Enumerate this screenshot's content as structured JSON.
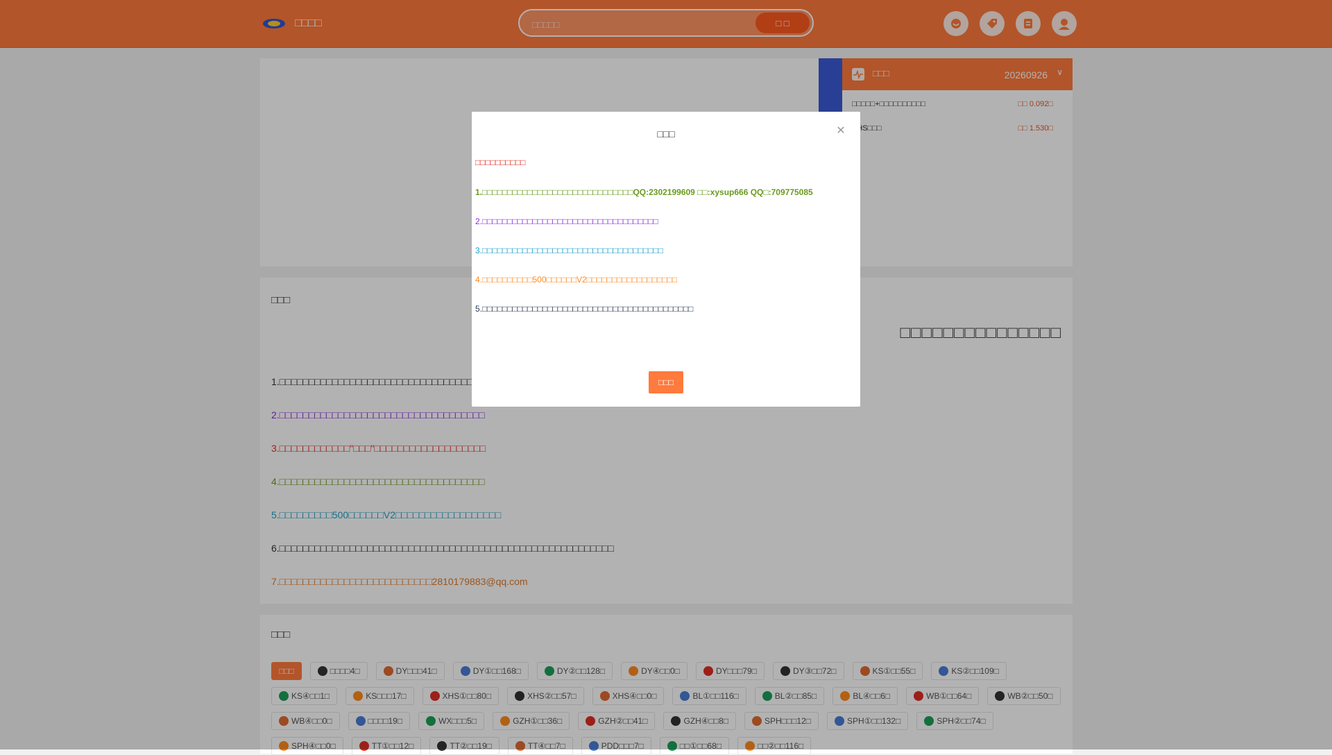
{
  "header": {
    "site_name": "□□□□",
    "search_placeholder": "□□□□□",
    "search_button": "□ □",
    "icons": [
      "service-icon",
      "tag-icon",
      "orders-icon",
      "user-avatar-icon"
    ]
  },
  "rank": {
    "title": "□□□",
    "date": "20260926",
    "rows": [
      {
        "name": "□□□□□+□□□□□□□□□□",
        "value": "□□ 0.092□"
      },
      {
        "name": "XHS□□□",
        "value": "□□ 1.530□"
      }
    ]
  },
  "notice": {
    "title": "□□□",
    "marquee": "□□□□□□□□□□□□□□□",
    "lines": [
      "1.□□□□□□□□□□□□□□□□□□□□□□□□□□□□□□□□□□□QQ",
      "2.□□□□□□□□□□□□□□□□□□□□□□□□□□□□□□□□□□□",
      "3.□□□□□□□□□□□□\"□□□\"□□□□□□□□□□□□□□□□□□□",
      "4.□□□□□□□□□□□□□□□□□□□□□□□□□□□□□□□□□□□",
      "5.□□□□□□□□□500□□□□□□V2□□□□□□□□□□□□□□□□□□",
      "6.□□□□□□□□□□□□□□□□□□□□□□□□□□□□□□□□□□□□□□□□□□□□□□□□□□□□□□□□□",
      "7.□□□□□□□□□□□□□□□□□□□□□□□□□□2810179883@qq.com"
    ]
  },
  "goods": {
    "title": "□□□",
    "tags": [
      {
        "label": "□□□",
        "active": true
      },
      {
        "label": "□□□□4□"
      },
      {
        "label": "DY□□□41□"
      },
      {
        "label": "DY①□□168□"
      },
      {
        "label": "DY②□□128□"
      },
      {
        "label": "DY④□□0□"
      },
      {
        "label": "DY□□□79□"
      },
      {
        "label": "DY③□□72□"
      },
      {
        "label": "KS①□□55□"
      },
      {
        "label": "KS②□□109□"
      },
      {
        "label": "KS④□□1□"
      },
      {
        "label": "KS□□□17□"
      },
      {
        "label": "XHS①□□80□"
      },
      {
        "label": "XHS②□□57□"
      },
      {
        "label": "XHS④□□0□"
      },
      {
        "label": "BL①□□116□"
      },
      {
        "label": "BL②□□85□"
      },
      {
        "label": "BL④□□6□"
      },
      {
        "label": "WB①□□64□"
      },
      {
        "label": "WB②□□50□"
      },
      {
        "label": "WB④□□0□"
      },
      {
        "label": "□□□□19□"
      },
      {
        "label": "WX□□□5□"
      },
      {
        "label": "GZH①□□36□"
      },
      {
        "label": "GZH②□□41□"
      },
      {
        "label": "GZH④□□8□"
      },
      {
        "label": "SPH□□□12□"
      },
      {
        "label": "SPH①□□132□"
      },
      {
        "label": "SPH②□□74□"
      },
      {
        "label": "SPH④□□0□"
      },
      {
        "label": "TT①□□12□"
      },
      {
        "label": "TT②□□19□"
      },
      {
        "label": "TT④□□7□"
      },
      {
        "label": "PDD□□□7□"
      },
      {
        "label": "□□①□□68□"
      },
      {
        "label": "□□②□□116□"
      }
    ]
  },
  "modal": {
    "title": "□□□",
    "intro": "□□□□□□□□□□",
    "lines": [
      "1.□□□□□□□□□□□□□□□□□□□□□□□□□□□□□□QQ:2302199609 □□:xysup666  QQ□:709775085",
      "2.□□□□□□□□□□□□□□□□□□□□□□□□□□□□□□□□□□□",
      "3.□□□□□□□□□□□□□□□□□□□□□□□□□□□□□□□□□□□□",
      "4.□□□□□□□□□□500□□□□□□V2□□□□□□□□□□□□□□□□□□",
      "5.□□□□□□□□□□□□□□□□□□□□□□□□□□□□□□□□□□□□□□□□□□"
    ],
    "ok_button": "□□□",
    "colors": {
      "red": "#e02e24",
      "green": "#6a9a1f",
      "purple": "#8a2be2",
      "cyan": "#1ea0c8",
      "orange": "#ff8a1f",
      "blue": "#2b6cb0",
      "dark": "#333333"
    }
  }
}
